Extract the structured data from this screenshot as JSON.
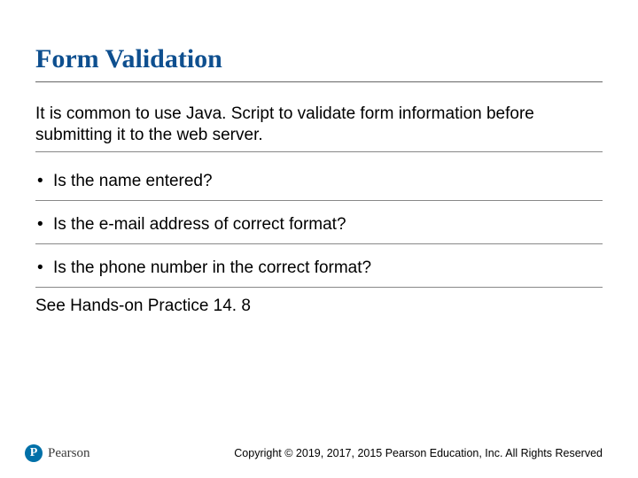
{
  "title": "Form Validation",
  "intro": "It is common to use Java. Script to validate form information before submitting it to the web server.",
  "bullets": [
    "Is the name entered?",
    "Is the e-mail address of correct format?",
    "Is the phone number in the correct format?"
  ],
  "closing": "See Hands-on Practice 14. 8",
  "logo": {
    "mark": "P",
    "text": "Pearson"
  },
  "copyright": "Copyright © 2019, 2017, 2015 Pearson Education, Inc. All Rights Reserved"
}
